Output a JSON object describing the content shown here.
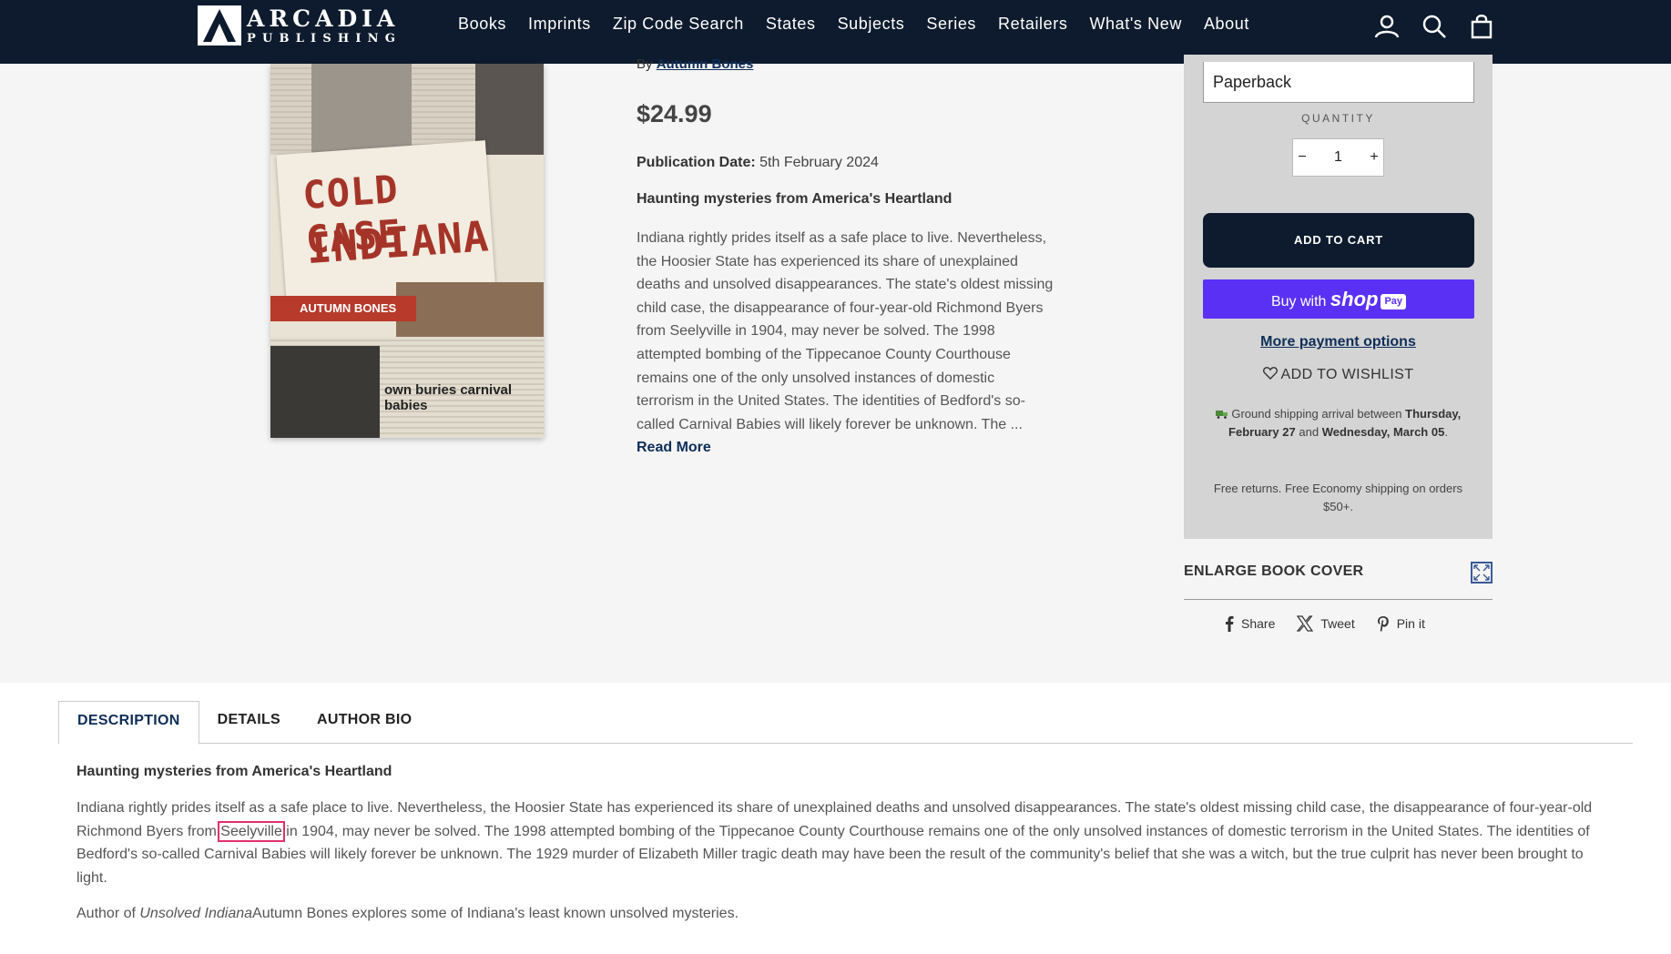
{
  "header": {
    "logo": {
      "line1": "ARCADIA",
      "line2": "PUBLISHING"
    },
    "nav": [
      "Books",
      "Imprints",
      "Zip Code Search",
      "States",
      "Subjects",
      "Series",
      "Retailers",
      "What's New",
      "About"
    ],
    "icons": [
      "account-icon",
      "search-icon",
      "cart-icon"
    ]
  },
  "product": {
    "cover": {
      "title_line1": "COLD CASE",
      "title_line2": "INDIANA",
      "author_band": "AUTUMN BONES",
      "strip_text": "own buries carnival babies"
    },
    "by_prefix": "By",
    "author": "Autumn Bones",
    "price": "$24.99",
    "pub_date_label": "Publication Date:",
    "pub_date_value": "5th February 2024",
    "tagline": "Haunting mysteries from America's Heartland",
    "blurb": "Indiana rightly prides itself as a safe place to live. Nevertheless, the Hoosier State has experienced its share of unexplained deaths and unsolved disappearances. The state's oldest missing child case, the disappearance of four-year-old Richmond Byers from Seelyville in 1904, may never be solved. The 1998 attempted bombing of the Tippecanoe County Courthouse remains one of the only unsolved instances of domestic terrorism in the United States. The identities of Bedford's so-called Carnival Babies will likely forever be unknown. The ...",
    "read_more": "Read More"
  },
  "buybox": {
    "format": "Paperback",
    "quantity_label": "QUANTITY",
    "qty_minus": "−",
    "qty_value": "1",
    "qty_plus": "+",
    "add_to_cart": "ADD TO CART",
    "buy_with": "Buy with",
    "shop_word": "shop",
    "pay_word": "Pay",
    "more_payment": "More payment options",
    "wishlist": "ADD TO WISHLIST",
    "ship_prefix": "Ground shipping arrival between",
    "ship_date1": "Thursday, February 27",
    "ship_and": "and",
    "ship_date2": "Wednesday, March 05",
    "ship_suffix": ".",
    "returns": "Free returns. Free Economy shipping on orders $50+."
  },
  "enlarge": {
    "label": "ENLARGE BOOK COVER"
  },
  "share": {
    "facebook": "Share",
    "x": "Tweet",
    "pinterest": "Pin it"
  },
  "tabs": [
    "DESCRIPTION",
    "DETAILS",
    "AUTHOR BIO"
  ],
  "description": {
    "tagline": "Haunting mysteries from America's Heartland",
    "body_before": "Indiana rightly prides itself as a safe place to live. Nevertheless, the Hoosier State has experienced its share of unexplained deaths and unsolved disappearances. The state's oldest missing child case, the disappearance of four-year-old Richmond Byers from ",
    "body_highlight": "Seelyville",
    "body_after": " in 1904, may never be solved. The 1998 attempted bombing of the Tippecanoe County Courthouse remains one of the only unsolved instances of domestic terrorism in the United States. The identities of Bedford's so-called Carnival Babies will likely forever be unknown. The 1929 murder of Elizabeth Miller tragic death may have been the result of the community's belief that she was a witch, but the true culprit has never been brought to light.",
    "author_prefix": "Author of ",
    "author_book": "Unsolved Indiana",
    "author_rest": "Autumn Bones explores some of Indiana's least known unsolved mysteries."
  },
  "colors": {
    "header_bg": "#0e1b2e",
    "link": "#0e2d58",
    "shop_pay": "#5a31f4",
    "highlight": "#e0306a",
    "buybox_bg": "#d4d4d4"
  }
}
